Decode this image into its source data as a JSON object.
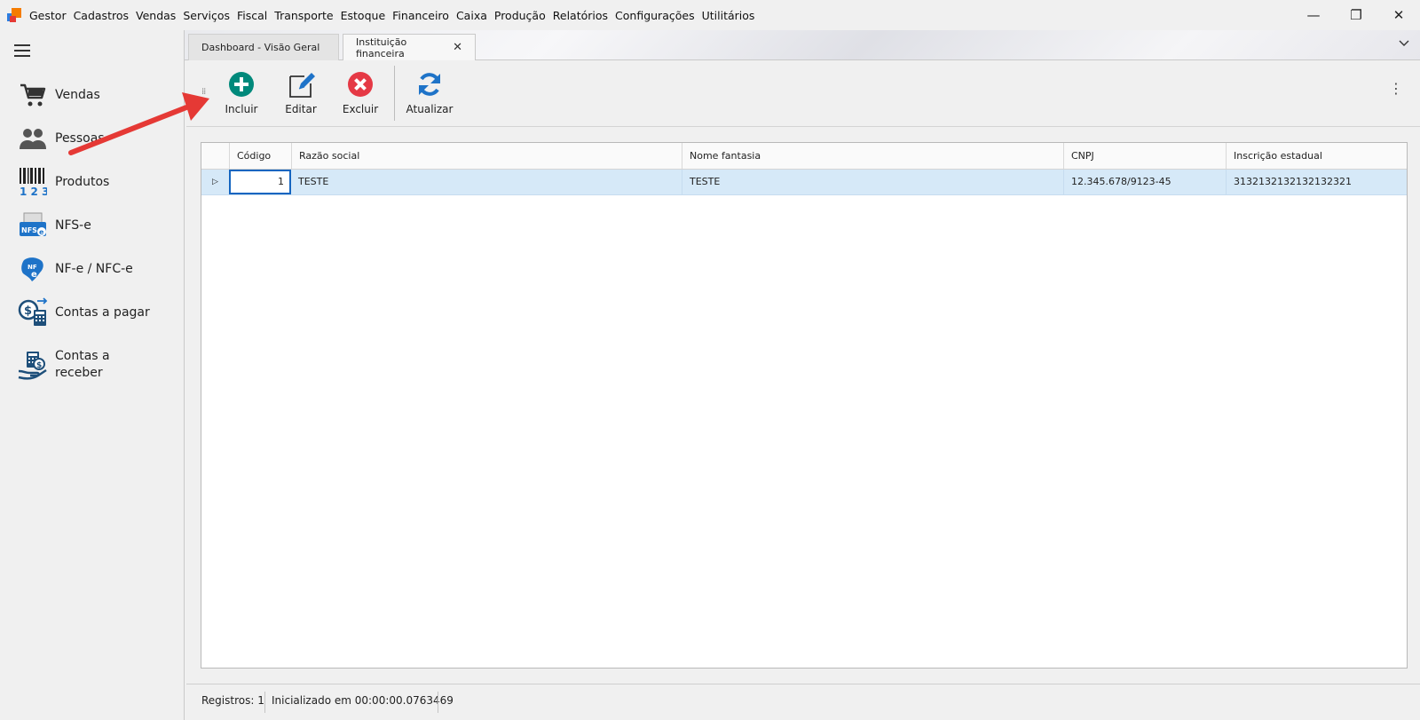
{
  "menubar": {
    "items": [
      "Gestor",
      "Cadastros",
      "Vendas",
      "Serviços",
      "Fiscal",
      "Transporte",
      "Estoque",
      "Financeiro",
      "Caixa",
      "Produção",
      "Relatórios",
      "Configurações",
      "Utilitários"
    ]
  },
  "window_controls": {
    "minimize": "—",
    "restore": "❐",
    "close": "✕"
  },
  "sidebar": {
    "items": [
      {
        "label": "Vendas",
        "icon": "shopping-cart-icon"
      },
      {
        "label": "Pessoas",
        "icon": "people-icon"
      },
      {
        "label": "Produtos",
        "icon": "barcode-icon"
      },
      {
        "label": "NFS-e",
        "icon": "nfse-icon"
      },
      {
        "label": "NF-e / NFC-e",
        "icon": "nfe-icon"
      },
      {
        "label": "Contas a pagar",
        "icon": "accounts-payable-icon"
      },
      {
        "label": "Contas a receber",
        "icon": "accounts-receivable-icon"
      }
    ]
  },
  "tabs": [
    {
      "label": "Dashboard - Visão Geral",
      "active": false
    },
    {
      "label": "Instituição financeira",
      "active": true,
      "close": "✕"
    }
  ],
  "toolbar": {
    "incluir": "Incluir",
    "editar": "Editar",
    "excluir": "Excluir",
    "atualizar": "Atualizar",
    "more": "⋮",
    "colors": {
      "incluir": "#00897b",
      "editar": "#1e73c8",
      "excluir": "#e53945",
      "atualizar": "#1e73c8"
    }
  },
  "grid": {
    "columns": [
      "Código",
      "Razão social",
      "Nome fantasia",
      "CNPJ",
      "Inscrição estadual"
    ],
    "rows": [
      {
        "codigo": "1",
        "razao_social": "TESTE",
        "nome_fantasia": "TESTE",
        "cnpj": "12.345.678/9123-45",
        "inscricao_estadual": "3132132132132132321"
      }
    ],
    "selected_row_color": "#d6e9f8"
  },
  "statusbar": {
    "registros": "Registros: 1",
    "inicializado": "Inicializado em 00:00:00.0763469"
  },
  "annotation": {
    "color": "#e53935"
  }
}
